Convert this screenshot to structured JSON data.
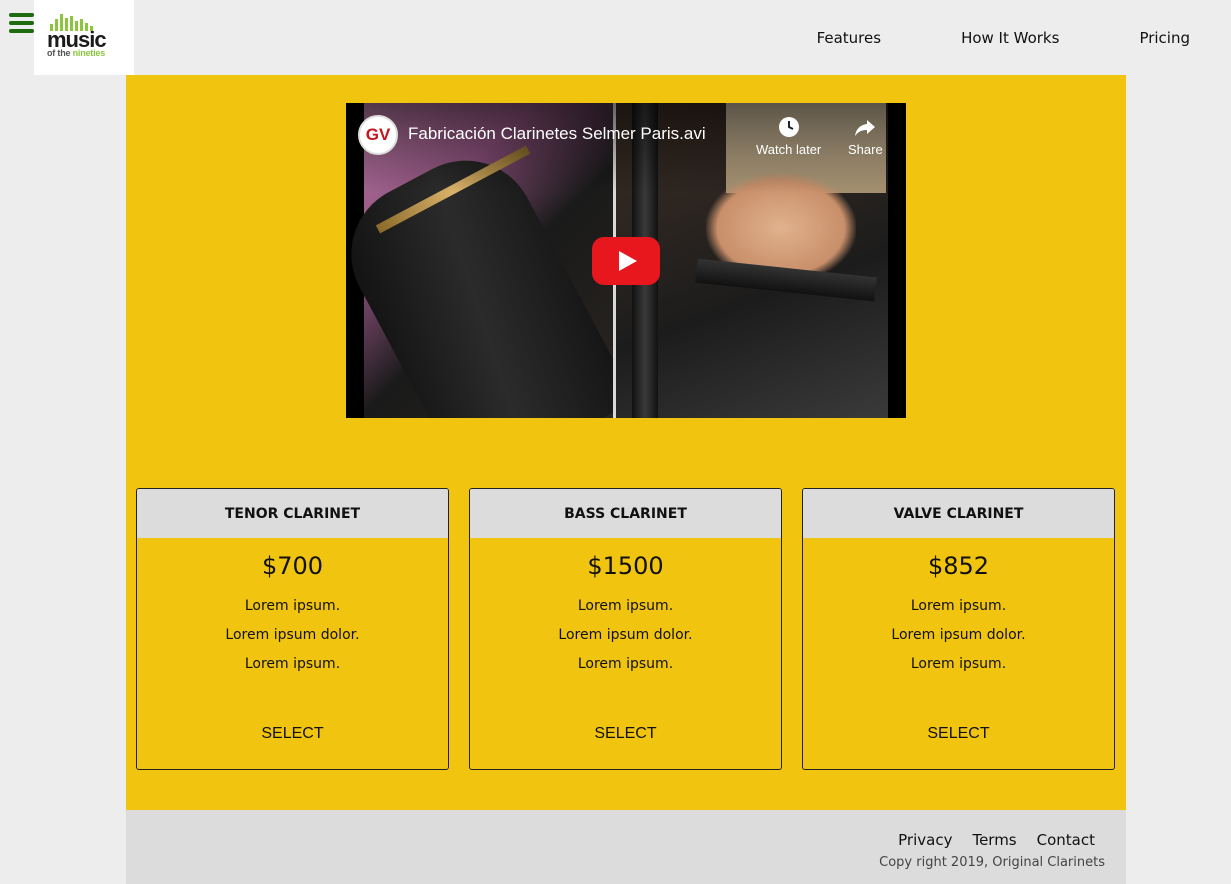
{
  "header": {
    "logo": {
      "word": "music",
      "sub_prefix": "of the",
      "sub_suffix": "nineties"
    },
    "nav": [
      {
        "label": "Features"
      },
      {
        "label": "How It Works"
      },
      {
        "label": "Pricing"
      }
    ]
  },
  "video": {
    "channel_badge": "GV",
    "title": "Fabricación Clarinetes Selmer Paris.avi",
    "watch_later_label": "Watch later",
    "share_label": "Share"
  },
  "cards": [
    {
      "title": "TENOR CLARINET",
      "price": "$700",
      "features": [
        "Lorem ipsum.",
        "Lorem ipsum dolor.",
        "Lorem ipsum."
      ],
      "button": "SELECT"
    },
    {
      "title": "BASS CLARINET",
      "price": "$1500",
      "features": [
        "Lorem ipsum.",
        "Lorem ipsum dolor.",
        "Lorem ipsum."
      ],
      "button": "SELECT"
    },
    {
      "title": "VALVE CLARINET",
      "price": "$852",
      "features": [
        "Lorem ipsum.",
        "Lorem ipsum dolor.",
        "Lorem ipsum."
      ],
      "button": "SELECT"
    }
  ],
  "footer": {
    "links": [
      {
        "label": "Privacy"
      },
      {
        "label": "Terms"
      },
      {
        "label": "Contact"
      }
    ],
    "copyright": "Copy right 2019, Original Clarinets"
  },
  "colors": {
    "panel": "#f1c410",
    "page_bg": "#ededed",
    "card_header": "#dcdcdc",
    "logo_green": "#8cc63f",
    "menu_green": "#1f6b12",
    "play_red": "#e8171e"
  },
  "icons": {
    "menu": "hamburger-icon",
    "watch_later": "clock-icon",
    "share": "share-arrow-icon",
    "play": "play-icon"
  }
}
